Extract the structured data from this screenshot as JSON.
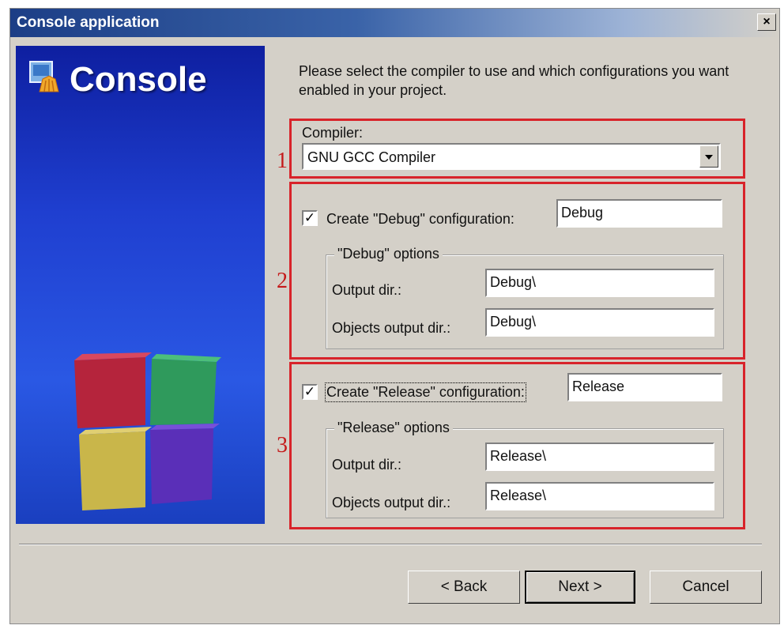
{
  "window": {
    "title": "Console application",
    "close_glyph": "×"
  },
  "banner": {
    "title": "Console",
    "icon": "console-app-icon",
    "logo": "code-blocks-logo"
  },
  "intro_text": "Please select the compiler to use and which configurations you want enabled in your project.",
  "annotations": {
    "n1": "1",
    "n2": "2",
    "n3": "3"
  },
  "compiler": {
    "label": "Compiler:",
    "value": "GNU GCC Compiler"
  },
  "debug": {
    "checkbox_label": "Create \"Debug\" configuration:",
    "checked": true,
    "name": "Debug",
    "group_title": "\"Debug\" options",
    "output_dir_label": "Output dir.:",
    "output_dir": "Debug\\",
    "objects_dir_label": "Objects output dir.:",
    "objects_dir": "Debug\\"
  },
  "release": {
    "checkbox_label": "Create \"Release\" configuration:",
    "checked": true,
    "name": "Release",
    "group_title": "\"Release\" options",
    "output_dir_label": "Output dir.:",
    "output_dir": "Release\\",
    "objects_dir_label": "Objects output dir.:",
    "objects_dir": "Release\\"
  },
  "buttons": {
    "back": "< Back",
    "next": "Next >",
    "cancel": "Cancel"
  },
  "colors": {
    "annotation_red": "#d8232a",
    "banner_blue": "#1f3fd0",
    "titlebar_blue": "#1c3e86"
  }
}
